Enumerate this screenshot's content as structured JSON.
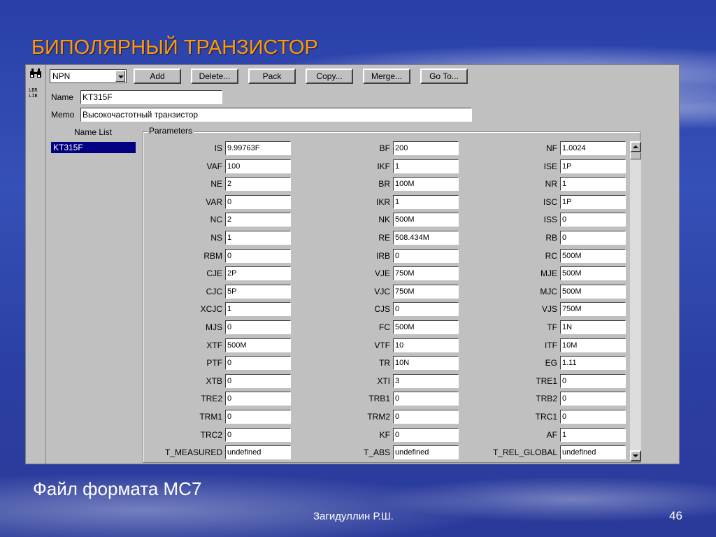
{
  "slide": {
    "title": "БИПОЛЯРНЫЙ ТРАНЗИСТОР",
    "subtitle": "Файл формата MC7",
    "author": "Загидуллин Р.Ш.",
    "page_number": "46"
  },
  "toolbar": {
    "type_select_value": "NPN",
    "add_label": "Add",
    "delete_label": "Delete...",
    "pack_label": "Pack",
    "copy_label": "Copy...",
    "merge_label": "Merge...",
    "goto_label": "Go To..."
  },
  "toolstrip": {
    "lib_icon_text_1": "LBR",
    "lib_icon_text_2": "LIB",
    "binoculars_icon": "binoculars-icon"
  },
  "form": {
    "name_label": "Name",
    "name_value": "KT315F",
    "memo_label": "Memo",
    "memo_value": "Высокочастотный транзистор",
    "name_list_label": "Name List",
    "name_list_items": [
      "KT315F"
    ],
    "parameters_label": "Parameters"
  },
  "parameters": [
    [
      [
        "IS",
        "9.99763F"
      ],
      [
        "BF",
        "200"
      ],
      [
        "NF",
        "1.0024"
      ]
    ],
    [
      [
        "VAF",
        "100"
      ],
      [
        "IKF",
        "1"
      ],
      [
        "ISE",
        "1P"
      ]
    ],
    [
      [
        "NE",
        "2"
      ],
      [
        "BR",
        "100M"
      ],
      [
        "NR",
        "1"
      ]
    ],
    [
      [
        "VAR",
        "0"
      ],
      [
        "IKR",
        "1"
      ],
      [
        "ISC",
        "1P"
      ]
    ],
    [
      [
        "NC",
        "2"
      ],
      [
        "NK",
        "500M"
      ],
      [
        "ISS",
        "0"
      ]
    ],
    [
      [
        "NS",
        "1"
      ],
      [
        "RE",
        "508.434M"
      ],
      [
        "RB",
        "0"
      ]
    ],
    [
      [
        "RBM",
        "0"
      ],
      [
        "IRB",
        "0"
      ],
      [
        "RC",
        "500M"
      ]
    ],
    [
      [
        "CJE",
        "2P"
      ],
      [
        "VJE",
        "750M"
      ],
      [
        "MJE",
        "500M"
      ]
    ],
    [
      [
        "CJC",
        "5P"
      ],
      [
        "VJC",
        "750M"
      ],
      [
        "MJC",
        "500M"
      ]
    ],
    [
      [
        "XCJC",
        "1"
      ],
      [
        "CJS",
        "0"
      ],
      [
        "VJS",
        "750M"
      ]
    ],
    [
      [
        "MJS",
        "0"
      ],
      [
        "FC",
        "500M"
      ],
      [
        "TF",
        "1N"
      ]
    ],
    [
      [
        "XTF",
        "500M"
      ],
      [
        "VTF",
        "10"
      ],
      [
        "ITF",
        "10M"
      ]
    ],
    [
      [
        "PTF",
        "0"
      ],
      [
        "TR",
        "10N"
      ],
      [
        "EG",
        "1.11"
      ]
    ],
    [
      [
        "XTB",
        "0"
      ],
      [
        "XTI",
        "3"
      ],
      [
        "TRE1",
        "0"
      ]
    ],
    [
      [
        "TRE2",
        "0"
      ],
      [
        "TRB1",
        "0"
      ],
      [
        "TRB2",
        "0"
      ]
    ],
    [
      [
        "TRM1",
        "0"
      ],
      [
        "TRM2",
        "0"
      ],
      [
        "TRC1",
        "0"
      ]
    ],
    [
      [
        "TRC2",
        "0"
      ],
      [
        "KF",
        "0"
      ],
      [
        "AF",
        "1"
      ]
    ],
    [
      [
        "T_MEASURED",
        "undefined"
      ],
      [
        "T_ABS",
        "undefined"
      ],
      [
        "T_REL_GLOBAL",
        "undefined"
      ]
    ]
  ]
}
